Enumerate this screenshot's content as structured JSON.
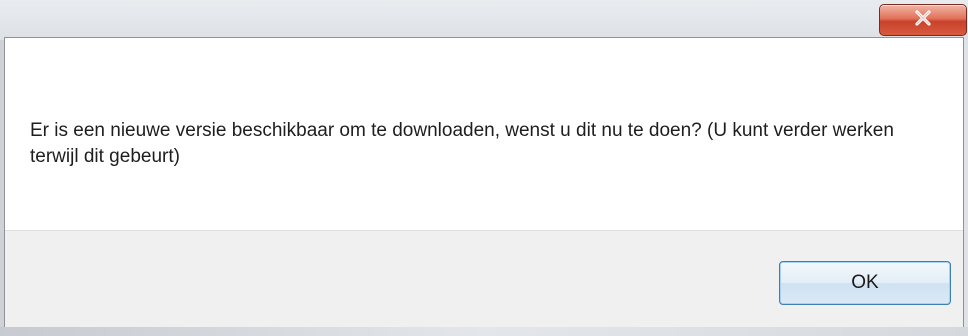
{
  "dialog": {
    "close_icon": "close-icon",
    "message": "Er is een nieuwe versie beschikbaar om te downloaden, wenst u dit nu te doen? (U kunt verder werken terwijl dit gebeurt)",
    "ok_label": "OK"
  },
  "colors": {
    "close_button": "#d95a3e",
    "ok_button_border": "#3c7fb1",
    "footer_background": "#f0f0f0",
    "content_background": "#ffffff"
  }
}
